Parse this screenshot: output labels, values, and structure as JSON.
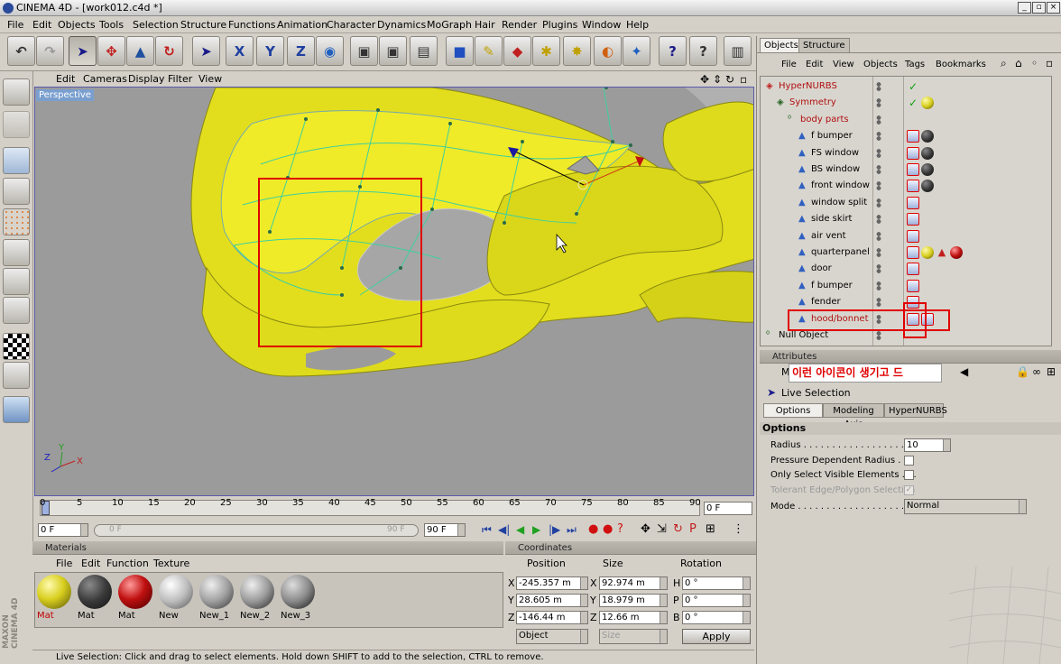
{
  "window": {
    "title": "CINEMA 4D - [work012.c4d *]",
    "min_btn": "_",
    "max_btn": "▫",
    "close_btn": "×"
  },
  "menubar": [
    "File",
    "Edit",
    "Objects",
    "Tools",
    "Selection",
    "Structure",
    "Functions",
    "Animation",
    "Character",
    "Dynamics",
    "MoGraph",
    "Hair",
    "Render",
    "Plugins",
    "Window",
    "Help"
  ],
  "viewport": {
    "menu": [
      "Edit",
      "Cameras",
      "Display",
      "Filter",
      "View"
    ],
    "label": "Perspective",
    "axis": {
      "x": "X",
      "y": "Y",
      "z": "Z"
    }
  },
  "timeline": {
    "ticks": [
      "0",
      "5",
      "10",
      "15",
      "20",
      "25",
      "30",
      "35",
      "40",
      "45",
      "50",
      "55",
      "60",
      "65",
      "70",
      "75",
      "80",
      "85",
      "90"
    ],
    "current_frame": "0 F",
    "start_field": "0 F",
    "slider_start": "0 F",
    "slider_end": "90 F",
    "end_field": "90 F"
  },
  "materials": {
    "title": "Materials",
    "menu": [
      "File",
      "Edit",
      "Function",
      "Texture"
    ],
    "items": [
      {
        "label": "Mat",
        "color": "#d8cf1e",
        "red": true
      },
      {
        "label": "Mat",
        "color": "#3a3a3a",
        "red": false
      },
      {
        "label": "Mat",
        "color": "#c01010",
        "red": false
      },
      {
        "label": "New",
        "color": "#bdbdbd",
        "red": false
      },
      {
        "label": "New_1",
        "color": "#a0a0a0",
        "red": false
      },
      {
        "label": "New_2",
        "color": "#9a9a9a",
        "red": false
      },
      {
        "label": "New_3",
        "color": "#8a8a8a",
        "red": false
      }
    ]
  },
  "coords": {
    "title": "Coordinates",
    "headers": {
      "position": "Position",
      "size": "Size",
      "rotation": "Rotation"
    },
    "rows": [
      {
        "axis": "X",
        "pos": "-245.357 m",
        "size_axis": "X",
        "size": "92.974 m",
        "rot_axis": "H",
        "rot": "0 °"
      },
      {
        "axis": "Y",
        "pos": "28.605 m",
        "size_axis": "Y",
        "size": "18.979 m",
        "rot_axis": "P",
        "rot": "0 °"
      },
      {
        "axis": "Z",
        "pos": "-146.44 m",
        "size_axis": "Z",
        "size": "12.66 m",
        "rot_axis": "B",
        "rot": "0 °"
      }
    ],
    "mode": "Object",
    "size_mode": "Size",
    "apply": "Apply"
  },
  "status": "Live Selection: Click and drag to select elements. Hold down SHIFT to add to the selection, CTRL to remove.",
  "side_brand": "MAXON CINEMA 4D",
  "objects": {
    "tabs": [
      "Objects",
      "Structure"
    ],
    "menu": [
      "File",
      "Edit",
      "View",
      "Objects",
      "Tags",
      "Bookmarks"
    ],
    "tree": [
      {
        "name": "HyperNURBS",
        "indent": 0,
        "red": true,
        "tags": [
          "check"
        ]
      },
      {
        "name": "Symmetry",
        "indent": 1,
        "red": true,
        "tags": [
          "check",
          "yellow"
        ]
      },
      {
        "name": "body parts",
        "indent": 2,
        "red": true,
        "tags": []
      },
      {
        "name": "f bumper",
        "indent": 3,
        "red": false,
        "tags": [
          "sel",
          "dark"
        ]
      },
      {
        "name": "FS window",
        "indent": 3,
        "red": false,
        "tags": [
          "sel",
          "dark"
        ]
      },
      {
        "name": "BS window",
        "indent": 3,
        "red": false,
        "tags": [
          "sel",
          "dark"
        ]
      },
      {
        "name": "front window",
        "indent": 3,
        "red": false,
        "tags": [
          "sel",
          "dark"
        ]
      },
      {
        "name": "window split",
        "indent": 3,
        "red": false,
        "tags": [
          "sel"
        ]
      },
      {
        "name": "side skirt",
        "indent": 3,
        "red": false,
        "tags": [
          "sel"
        ]
      },
      {
        "name": "air vent",
        "indent": 3,
        "red": false,
        "tags": [
          "sel"
        ]
      },
      {
        "name": "quarterpanel",
        "indent": 3,
        "red": false,
        "tags": [
          "sel",
          "yellow",
          "tri",
          "red"
        ]
      },
      {
        "name": "door",
        "indent": 3,
        "red": false,
        "tags": [
          "sel"
        ]
      },
      {
        "name": "f bumper",
        "indent": 3,
        "red": false,
        "tags": [
          "sel"
        ]
      },
      {
        "name": "fender",
        "indent": 3,
        "red": false,
        "tags": [
          "sel"
        ]
      },
      {
        "name": "hood/bonnet",
        "indent": 3,
        "red": true,
        "tags": [
          "sel",
          "sel"
        ]
      },
      {
        "name": "Null Object",
        "indent": 0,
        "red": false,
        "tags": []
      }
    ]
  },
  "attributes": {
    "title": "Attributes",
    "mode_letter": "M",
    "annotation": "이런 아이콘이 생기고 드",
    "tool_name": "Live Selection",
    "tabs": [
      "Options",
      "Modeling Axis",
      "HyperNURBS"
    ],
    "section": "Options",
    "radius_label": "Radius . . . . . . . . . . . . . . . . . .",
    "radius_value": "10",
    "pressure_label": "Pressure Dependent Radius . . .",
    "visible_label": "Only Select Visible Elements . . .",
    "tolerant_label": "Tolerant Edge/Polygon Selection",
    "mode_label": "Mode . . . . . . . . . . . . . . . . . . .",
    "mode_value": "Normal"
  }
}
